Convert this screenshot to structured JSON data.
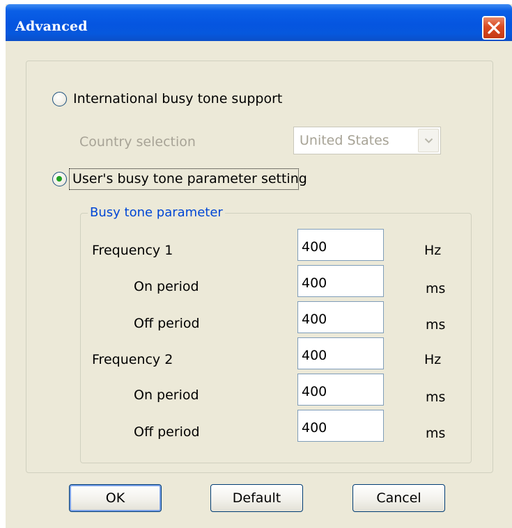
{
  "window": {
    "title": "Advanced",
    "close_icon": "close-icon"
  },
  "busy_tone": {
    "international_option": {
      "label": "International busy tone support",
      "selected": false
    },
    "country_selection": {
      "label": "Country selection",
      "value": "United States",
      "enabled": false
    },
    "user_option": {
      "label": "User's busy tone parameter setting",
      "selected": true
    }
  },
  "parameters": {
    "legend": "Busy tone parameter",
    "rows": [
      {
        "label": "Frequency 1",
        "value": "400",
        "unit": "Hz"
      },
      {
        "label": "On period",
        "value": "400",
        "unit": "ms"
      },
      {
        "label": "Off period",
        "value": "400",
        "unit": "ms"
      },
      {
        "label": "Frequency 2",
        "value": "400",
        "unit": "Hz"
      },
      {
        "label": "On period",
        "value": "400",
        "unit": "ms"
      },
      {
        "label": "Off period",
        "value": "400",
        "unit": "ms"
      }
    ]
  },
  "buttons": {
    "ok": "OK",
    "default": "Default",
    "cancel": "Cancel"
  },
  "colors": {
    "title_bar": "#0555e0",
    "close_button": "#d94a22",
    "dialog_background": "#ece9d8",
    "group_legend": "#0046d5",
    "radio_selected_dot": "#21a121",
    "disabled_text": "#a7a396"
  }
}
